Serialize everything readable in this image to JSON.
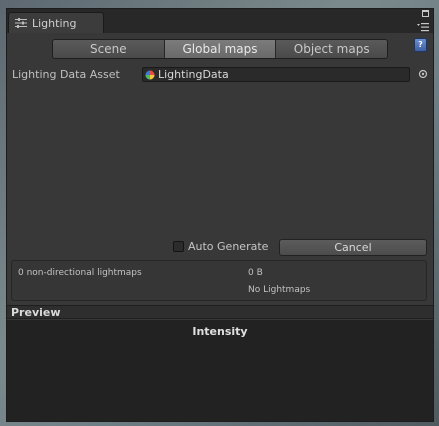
{
  "window": {
    "tab_title": "Lighting",
    "tab_icon": "lighting-settings-icon",
    "controls": [
      "maximize-icon",
      "panel-menu-icon"
    ]
  },
  "tabs": {
    "items": [
      {
        "label": "Scene",
        "active": false
      },
      {
        "label": "Global maps",
        "active": true
      },
      {
        "label": "Object maps",
        "active": false
      }
    ]
  },
  "help": {
    "icon": "help-book-icon",
    "glyph": "?"
  },
  "lighting_data": {
    "label": "Lighting Data Asset",
    "value": "LightingData",
    "asset_icon": "lighting-data-asset-icon",
    "picker_icon": "object-picker-icon"
  },
  "actions": {
    "auto_generate_label": "Auto Generate",
    "auto_generate_checked": false,
    "cancel_label": "Cancel"
  },
  "stats": {
    "lightmap_count": "0 non-directional lightmaps",
    "size": "0 B",
    "status": "No Lightmaps"
  },
  "preview": {
    "header": "Preview",
    "intensity_label": "Intensity"
  },
  "colors": {
    "panel_bg": "#383838",
    "active_tab": "#6a6a6a",
    "preview_bg": "#222222",
    "help_accent": "#4a6fb8"
  }
}
